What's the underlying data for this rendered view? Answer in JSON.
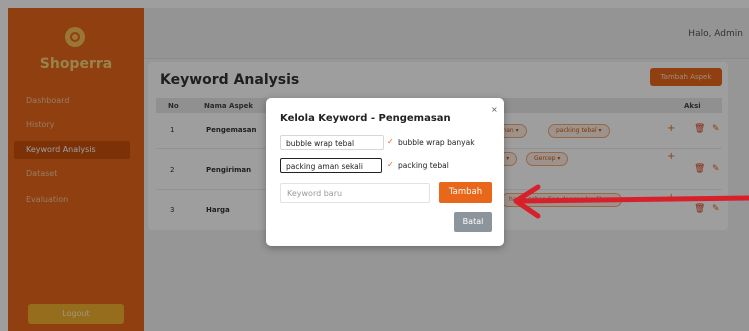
{
  "app": {
    "brand": "Shoperra"
  },
  "sidebar": {
    "items": [
      {
        "label": "Dashboard",
        "active": false
      },
      {
        "label": "History",
        "active": false
      },
      {
        "label": "Keyword Analysis",
        "active": true
      },
      {
        "label": "Dataset",
        "active": false
      },
      {
        "label": "Evaluation",
        "active": false
      }
    ],
    "logout_label": "Logout"
  },
  "topbar": {
    "greeting": "Halo, Admin"
  },
  "page": {
    "title": "Keyword Analysis",
    "add_button": "Tambah Aspek",
    "columns": {
      "no": "No",
      "aspect": "Nama Aspek",
      "action": "Aksi"
    },
    "rows": [
      {
        "no": "1",
        "aspect": "Pengemasan",
        "tags": [
          "g aman",
          "packing tebal"
        ]
      },
      {
        "no": "2",
        "aspect": "Pengiriman",
        "tags": [
          "aktu",
          "Gercep"
        ]
      },
      {
        "no": "3",
        "aspect": "Harga",
        "tags": [
          "harga sebanding dengan kualitas"
        ]
      }
    ]
  },
  "modal": {
    "title": "Kelola Keyword - Pengemasan",
    "close": "×",
    "keywords": [
      {
        "edit_value": "bubble wrap tebal",
        "label": "bubble wrap banyak"
      },
      {
        "edit_value": "packing aman sekali",
        "label": "packing tebal"
      }
    ],
    "new_placeholder": "Keyword baru",
    "add_button": "Tambah",
    "cancel_button": "Batal"
  },
  "colors": {
    "accent": "#e8671a",
    "sidebar": "#e8671a",
    "arrow": "#d8202a",
    "cancel": "#8d959c"
  },
  "icons": {
    "logo": "logo-ring-icon",
    "close": "close-icon",
    "check": "check-icon",
    "delete": "trash-icon",
    "edit": "edit-icon",
    "plus": "plus-icon",
    "annotation": "red-arrow-icon"
  }
}
